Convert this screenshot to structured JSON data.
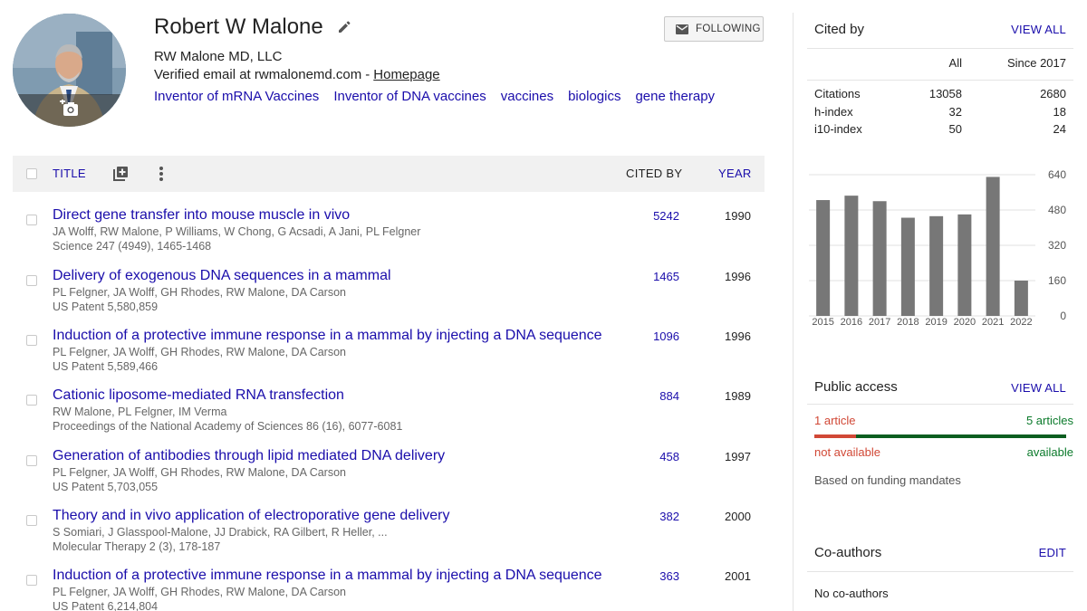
{
  "profile": {
    "name": "Robert W Malone",
    "affiliation": "RW Malone MD, LLC",
    "email_text": "Verified email at rwmalonemd.com",
    "email_separator": "-",
    "homepage_label": "Homepage",
    "interests": [
      "Inventor of mRNA Vaccines",
      "Inventor of DNA vaccines",
      "vaccines",
      "biologics",
      "gene therapy"
    ],
    "follow_label": "FOLLOWING"
  },
  "table": {
    "title_header": "TITLE",
    "cited_header": "CITED BY",
    "year_header": "YEAR",
    "rows": [
      {
        "title": "Direct gene transfer into mouse muscle in vivo",
        "authors": "JA Wolff, RW Malone, P Williams, W Chong, G Acsadi, A Jani, PL Felgner",
        "venue": "Science 247 (4949), 1465-1468",
        "cited": "5242",
        "year": "1990"
      },
      {
        "title": "Delivery of exogenous DNA sequences in a mammal",
        "authors": "PL Felgner, JA Wolff, GH Rhodes, RW Malone, DA Carson",
        "venue": "US Patent 5,580,859",
        "cited": "1465",
        "year": "1996"
      },
      {
        "title": "Induction of a protective immune response in a mammal by injecting a DNA sequence",
        "authors": "PL Felgner, JA Wolff, GH Rhodes, RW Malone, DA Carson",
        "venue": "US Patent 5,589,466",
        "cited": "1096",
        "year": "1996"
      },
      {
        "title": "Cationic liposome-mediated RNA transfection",
        "authors": "RW Malone, PL Felgner, IM Verma",
        "venue": "Proceedings of the National Academy of Sciences 86 (16), 6077-6081",
        "cited": "884",
        "year": "1989"
      },
      {
        "title": "Generation of antibodies through lipid mediated DNA delivery",
        "authors": "PL Felgner, JA Wolff, GH Rhodes, RW Malone, DA Carson",
        "venue": "US Patent 5,703,055",
        "cited": "458",
        "year": "1997"
      },
      {
        "title": "Theory and in vivo application of electroporative gene delivery",
        "authors": "S Somiari, J Glasspool-Malone, JJ Drabick, RA Gilbert, R Heller, ...",
        "venue": "Molecular Therapy 2 (3), 178-187",
        "cited": "382",
        "year": "2000"
      },
      {
        "title": "Induction of a protective immune response in a mammal by injecting a DNA sequence",
        "authors": "PL Felgner, JA Wolff, GH Rhodes, RW Malone, DA Carson",
        "venue": "US Patent 6,214,804",
        "cited": "363",
        "year": "2001"
      }
    ]
  },
  "cited_by": {
    "heading": "Cited by",
    "view_all": "VIEW ALL",
    "col_all": "All",
    "col_since": "Since 2017",
    "rows": [
      {
        "label": "Citations",
        "all": "13058",
        "since": "2680"
      },
      {
        "label": "h-index",
        "all": "32",
        "since": "18"
      },
      {
        "label": "i10-index",
        "all": "50",
        "since": "24"
      }
    ]
  },
  "chart_data": {
    "type": "bar",
    "categories": [
      "2015",
      "2016",
      "2017",
      "2018",
      "2019",
      "2020",
      "2021",
      "2022"
    ],
    "values": [
      525,
      545,
      520,
      445,
      452,
      460,
      630,
      160
    ],
    "yticks": [
      "0",
      "160",
      "320",
      "480",
      "640"
    ],
    "ylim": [
      0,
      640
    ],
    "grid": true,
    "bar_color": "#777777"
  },
  "public_access": {
    "heading": "Public access",
    "view_all": "VIEW ALL",
    "left_count": "1 article",
    "right_count": "5 articles",
    "left_status": "not available",
    "right_status": "available",
    "available_fraction": 0.833,
    "note": "Based on funding mandates"
  },
  "coauthors": {
    "heading": "Co-authors",
    "edit": "EDIT",
    "empty": "No co-authors"
  }
}
